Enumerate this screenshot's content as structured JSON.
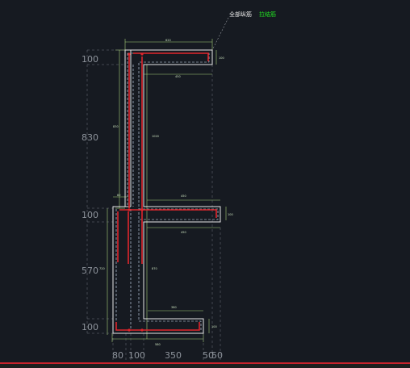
{
  "annotation": {
    "label_white": "全部纵筋",
    "label_green": "拉结筋"
  },
  "dimensions_left": [
    "100",
    "830",
    "100",
    "570",
    "100"
  ],
  "dimensions_bottom": [
    "80",
    "100",
    "350",
    "50",
    "50"
  ],
  "dimensions_small": {
    "top_width": "620",
    "top_right": "100",
    "top_inner": "450",
    "left_vertical": "830",
    "inner_vertical": "1020",
    "mid_top": "80",
    "mid_right_top": "450",
    "mid_right": "100",
    "mid_right_bottom": "450",
    "lower_left": "720",
    "lower_inner": "870",
    "bottom_inner": "380",
    "bottom_right": "100",
    "bottom_width": "580"
  },
  "colors": {
    "background": "#161a21",
    "outline": "#e6e6e6",
    "rebar": "#e0262c",
    "tie": "#d8e8ff",
    "dimension": "#a8d07a",
    "dim_text_large": "#8e949c",
    "annotation_green": "#22dd22",
    "bottom_bar": "#c8232c"
  }
}
